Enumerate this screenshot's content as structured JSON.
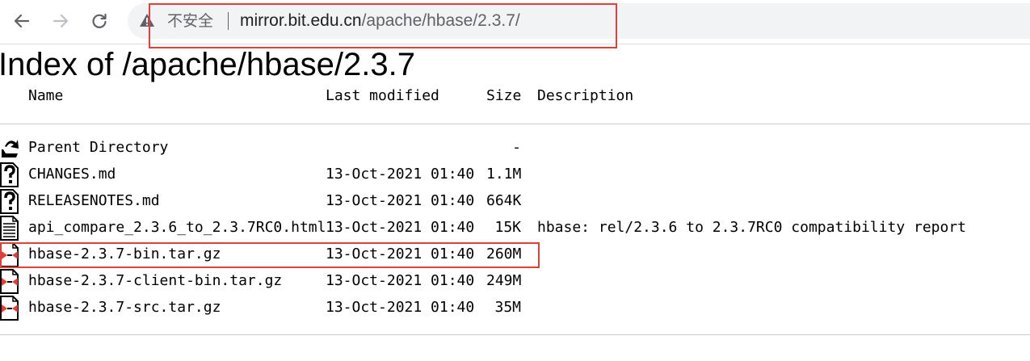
{
  "browser": {
    "security_label": "不安全",
    "url_host": "mirror.bit.edu.cn",
    "url_path": "/apache/hbase/2.3.7/"
  },
  "page": {
    "title": "Index of /apache/hbase/2.3.7",
    "columns": {
      "name": "Name",
      "last_modified": "Last modified",
      "size": "Size",
      "description": "Description"
    },
    "rows": [
      {
        "icon": "parent-directory-icon",
        "name": "Parent Directory",
        "modified": "",
        "size": "-",
        "description": ""
      },
      {
        "icon": "unknown-file-icon",
        "name": "CHANGES.md",
        "modified": "13-Oct-2021 01:40",
        "size": "1.1M",
        "description": ""
      },
      {
        "icon": "unknown-file-icon",
        "name": "RELEASENOTES.md",
        "modified": "13-Oct-2021 01:40",
        "size": "664K",
        "description": ""
      },
      {
        "icon": "text-file-icon",
        "name": "api_compare_2.3.6_to_2.3.7RC0.html",
        "modified": "13-Oct-2021 01:40",
        "size": "15K",
        "description": "hbase: rel/2.3.6 to 2.3.7RC0 compatibility report"
      },
      {
        "icon": "compressed-file-icon",
        "name": "hbase-2.3.7-bin.tar.gz",
        "modified": "13-Oct-2021 01:40",
        "size": "260M",
        "description": ""
      },
      {
        "icon": "compressed-file-icon",
        "name": "hbase-2.3.7-client-bin.tar.gz",
        "modified": "13-Oct-2021 01:40",
        "size": "249M",
        "description": ""
      },
      {
        "icon": "compressed-file-icon",
        "name": "hbase-2.3.7-src.tar.gz",
        "modified": "13-Oct-2021 01:40",
        "size": "35M",
        "description": ""
      }
    ]
  },
  "highlight_color": "#e0403a"
}
